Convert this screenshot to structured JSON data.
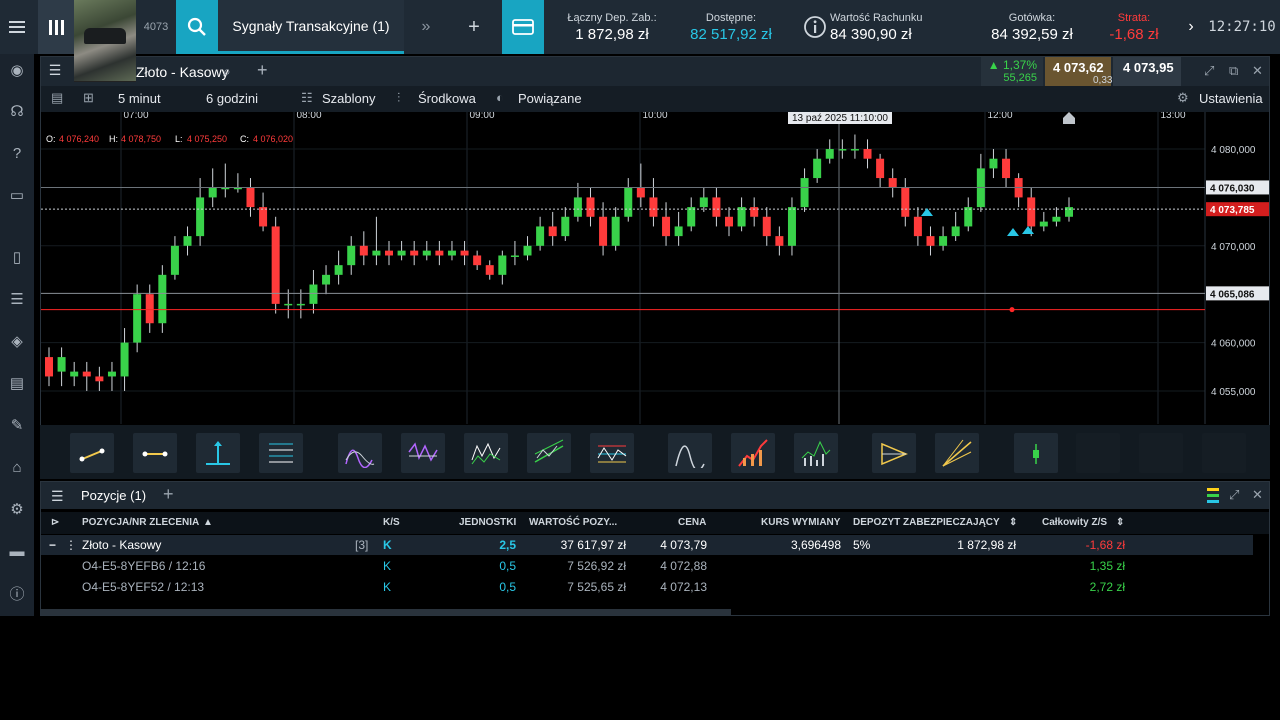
{
  "topbar": {
    "ticker_fragment": "4073",
    "tab_label": "Sygnały Transakcyjne (1)",
    "metrics": {
      "deposit": {
        "label": "Łączny Dep. Zab.:",
        "value": "1 872,98 zł"
      },
      "available": {
        "label": "Dostępne:",
        "value": "82 517,92 zł"
      },
      "account_value": {
        "label": "Wartość Rachunku",
        "value": "84 390,90 zł"
      },
      "cash": {
        "label": "Gotówka:",
        "value": "84 392,59 zł"
      },
      "loss": {
        "label": "Strata:",
        "value": "-1,68 zł"
      }
    },
    "clock": "12:27:10"
  },
  "chart_panel": {
    "instrument": "Złoto - Kasowy",
    "change_pct": "▲ 1,37%",
    "change_abs": "55,265",
    "sell_price": "4 073,62",
    "spread": "0,33",
    "buy_price": "4 073,95",
    "toolbar": {
      "interval": "5 minut",
      "range": "6 godzini",
      "templates": "Szablony",
      "indicator": "Środkowa",
      "related": "Powiązane",
      "settings": "Ustawienia"
    }
  },
  "chart_data": {
    "type": "candlestick",
    "ohlc_legend": {
      "o": "4 076,240",
      "h": "4 078,750",
      "l": "4 075,250",
      "c": "4 076,020"
    },
    "x_ticks": [
      "07:00",
      "08:00",
      "09:00",
      "10:00",
      "12:00",
      "13:00"
    ],
    "crosshair_label": "13 paź 2025 11:10:00",
    "y_ticks": [
      "4 080,000",
      "4 070,000",
      "4 060,000",
      "4 055,000"
    ],
    "y_range": [
      4052,
      4083
    ],
    "price_labels": {
      "crosshair": "4 076,030",
      "current": "4 073,785",
      "line": "4 065,086"
    },
    "candles": [
      [
        4058.5,
        4056.5,
        4059.5,
        4055.5
      ],
      [
        4057,
        4058.5,
        4059.5,
        4055.5
      ],
      [
        4056.5,
        4057,
        4058.0,
        4055.5
      ],
      [
        4057,
        4056.5,
        4058.0,
        4055.0
      ],
      [
        4056.5,
        4056,
        4057.5,
        4055.0
      ],
      [
        4056.5,
        4057,
        4058.0,
        4055.0
      ],
      [
        4056.5,
        4060,
        4061.5,
        4055.0
      ],
      [
        4060,
        4065,
        4066.0,
        4059.0
      ],
      [
        4065,
        4062,
        4066.0,
        4061.0
      ],
      [
        4062,
        4067,
        4068.0,
        4061.0
      ],
      [
        4067,
        4070,
        4071.0,
        4066.5
      ],
      [
        4070,
        4071,
        4072.0,
        4069.0
      ],
      [
        4071,
        4075,
        4077.0,
        4070.0
      ],
      [
        4075,
        4076,
        4078.0,
        4074.0
      ],
      [
        4076,
        4076,
        4078.5,
        4075.0
      ],
      [
        4076,
        4076,
        4077.5,
        4075.5
      ],
      [
        4076,
        4074,
        4077.0,
        4073.0
      ],
      [
        4074,
        4072,
        4075.5,
        4071.5
      ],
      [
        4072,
        4064,
        4073.0,
        4063.0
      ],
      [
        4064,
        4064,
        4065.5,
        4062.5
      ],
      [
        4064,
        4064,
        4065.5,
        4062.5
      ],
      [
        4064,
        4066,
        4067.5,
        4063.0
      ],
      [
        4066,
        4067,
        4068.0,
        4065.0
      ],
      [
        4067,
        4068,
        4069.5,
        4066.0
      ],
      [
        4068,
        4070,
        4071.0,
        4067.0
      ],
      [
        4070,
        4069,
        4071.5,
        4068.0
      ],
      [
        4069,
        4069.5,
        4073.0,
        4068.0
      ],
      [
        4069.5,
        4069,
        4070.5,
        4068.0
      ],
      [
        4069,
        4069.5,
        4070.5,
        4068.5
      ],
      [
        4069.5,
        4069,
        4070.5,
        4068.0
      ],
      [
        4069,
        4069.5,
        4070.5,
        4068.5
      ],
      [
        4069.5,
        4069,
        4070.5,
        4068.0
      ],
      [
        4069,
        4069.5,
        4070.5,
        4068.5
      ],
      [
        4069.5,
        4069,
        4070.5,
        4068.0
      ],
      [
        4069,
        4068,
        4069.5,
        4067.5
      ],
      [
        4068,
        4067,
        4068.5,
        4066.5
      ],
      [
        4067,
        4069,
        4069.5,
        4066.0
      ],
      [
        4069,
        4069,
        4070.5,
        4068.0
      ],
      [
        4069,
        4070,
        4071.0,
        4068.5
      ],
      [
        4070,
        4072,
        4073.0,
        4069.5
      ],
      [
        4072,
        4071,
        4073.5,
        4070.0
      ],
      [
        4071,
        4073,
        4074.0,
        4070.5
      ],
      [
        4073,
        4075,
        4076.5,
        4072.5
      ],
      [
        4075,
        4073,
        4076.0,
        4072.0
      ],
      [
        4073,
        4070,
        4074.5,
        4069.0
      ],
      [
        4070,
        4073,
        4074.0,
        4069.5
      ],
      [
        4073,
        4076,
        4077.0,
        4072.5
      ],
      [
        4076,
        4075,
        4078.5,
        4074.0
      ],
      [
        4075,
        4073,
        4077.0,
        4072.0
      ],
      [
        4073,
        4071,
        4074.5,
        4070.0
      ],
      [
        4071,
        4072,
        4073.5,
        4070.0
      ],
      [
        4072,
        4074,
        4075.0,
        4071.5
      ],
      [
        4074,
        4075,
        4076.0,
        4073.5
      ],
      [
        4075,
        4073,
        4076.0,
        4072.0
      ],
      [
        4073,
        4072,
        4074.0,
        4071.0
      ],
      [
        4072,
        4074,
        4075.0,
        4071.5
      ],
      [
        4074,
        4073,
        4075.0,
        4072.0
      ],
      [
        4073,
        4071,
        4074.0,
        4070.0
      ],
      [
        4071,
        4070,
        4072.0,
        4069.0
      ],
      [
        4070,
        4074,
        4075.0,
        4069.0
      ],
      [
        4074,
        4077,
        4078.0,
        4073.5
      ],
      [
        4077,
        4079,
        4080.0,
        4076.5
      ],
      [
        4079,
        4080,
        4081.0,
        4078.5
      ],
      [
        4080,
        4080,
        4081.0,
        4079.0
      ],
      [
        4080,
        4080,
        4081.5,
        4079.0
      ],
      [
        4080,
        4079,
        4081.0,
        4078.0
      ],
      [
        4079,
        4077,
        4079.5,
        4076.0
      ],
      [
        4077,
        4076,
        4078.0,
        4075.0
      ],
      [
        4076,
        4073,
        4077.0,
        4072.0
      ],
      [
        4073,
        4071,
        4074.0,
        4070.0
      ],
      [
        4071,
        4070,
        4072.0,
        4069.0
      ],
      [
        4070,
        4071,
        4072.0,
        4069.5
      ],
      [
        4071,
        4072,
        4073.5,
        4070.5
      ],
      [
        4072,
        4074,
        4075.0,
        4071.5
      ],
      [
        4074,
        4078,
        4079.5,
        4073.5
      ],
      [
        4078,
        4079,
        4080.0,
        4077.0
      ],
      [
        4079,
        4077,
        4080.0,
        4076.0
      ],
      [
        4077,
        4075,
        4077.5,
        4074.0
      ],
      [
        4075,
        4072,
        4076.0,
        4071.0
      ],
      [
        4072,
        4072.5,
        4073.5,
        4071.5
      ],
      [
        4072.5,
        4073,
        4074.0,
        4072.0
      ],
      [
        4073,
        4074,
        4075.0,
        4072.5
      ]
    ]
  },
  "tools_row": {
    "tools": [
      "trend-line-tool",
      "horizontal-line-tool",
      "vertical-line-tool",
      "fibonacci-tool",
      "oscillator-tool",
      "stochastic-tool",
      "macd-tool",
      "channel-tool",
      "bands-tool",
      "wave-tool",
      "volume-profile-tool",
      "histogram-tool",
      "arrow-pattern-tool",
      "pitchfork-tool",
      "price-marker-tool"
    ]
  },
  "positions": {
    "title": "Pozycje (1)",
    "columns": [
      "POZYCJA/NR ZLECENIA",
      "K/S",
      "JEDNOSTKI",
      "WARTOŚĆ POZY...",
      "CENA",
      "KURS WYMIANY",
      "DEPOZYT ZABEZPIECZAJĄCY",
      "Całkowity Z/S"
    ],
    "main": {
      "name": "Złoto - Kasowy",
      "count": "[3]",
      "side": "K",
      "units": "2,5",
      "value": "37 617,97 zł",
      "price": "4 073,79",
      "fx": "3,696498",
      "margin_pct": "5%",
      "margin": "1 872,98 zł",
      "pl": "-1,68 zł"
    },
    "orders": [
      {
        "id": "O4-E5-8YEFB6 / 12:16",
        "side": "K",
        "units": "0,5",
        "value": "7 526,92 zł",
        "price": "4 072,88",
        "pl": "1,35 zł"
      },
      {
        "id": "O4-E5-8YEF52 / 12:13",
        "side": "K",
        "units": "0,5",
        "value": "7 525,65 zł",
        "price": "4 072,13",
        "pl": "2,72 zł"
      }
    ]
  },
  "colors": {
    "accent": "#18a5c2",
    "up": "#39d24a",
    "down": "#ff3b3b",
    "bg": "#000000"
  }
}
